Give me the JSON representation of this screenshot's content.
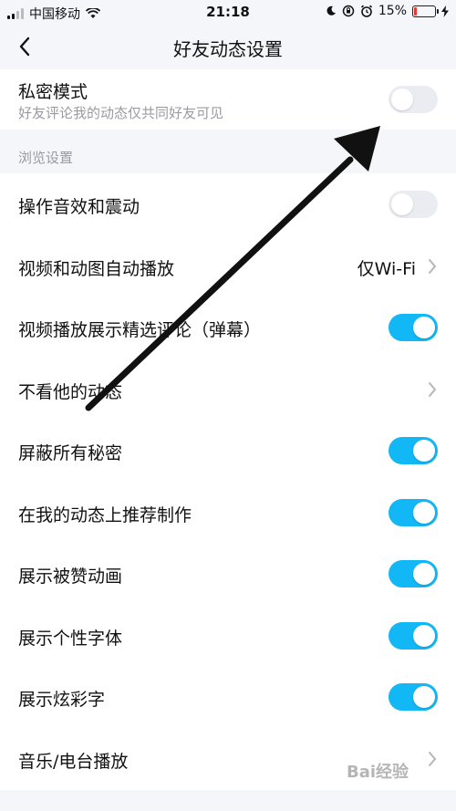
{
  "status_bar": {
    "carrier": "中国移动",
    "time": "21:18",
    "battery_percent": "15%",
    "battery_level": 0.15,
    "icons": [
      "signal-icon",
      "wifi-icon",
      "moon-icon",
      "rotation-lock-icon",
      "alarm-icon",
      "battery-icon",
      "charging-icon"
    ],
    "battery_color": "#e53935"
  },
  "nav": {
    "title": "好友动态设置",
    "back_icon": "chevron-left-icon"
  },
  "privacy": {
    "label": "私密模式",
    "sub": "好友评论我的动态仅共同好友可见",
    "on": false
  },
  "section": {
    "label": "浏览设置"
  },
  "rows": [
    {
      "label": "操作音效和震动",
      "type": "toggle",
      "on": false
    },
    {
      "label": "视频和动图自动播放",
      "type": "link",
      "value": "仅Wi-Fi"
    },
    {
      "label": "视频播放展示精选评论（弹幕）",
      "type": "toggle",
      "on": true
    },
    {
      "label": "不看他的动态",
      "type": "link"
    },
    {
      "label": "屏蔽所有秘密",
      "type": "toggle",
      "on": true
    },
    {
      "label": "在我的动态上推荐制作",
      "type": "toggle",
      "on": true
    },
    {
      "label": "展示被赞动画",
      "type": "toggle",
      "on": true
    },
    {
      "label": "展示个性字体",
      "type": "toggle",
      "on": true
    },
    {
      "label": "展示炫彩字",
      "type": "toggle",
      "on": true
    },
    {
      "label": "音乐/电台播放",
      "type": "link"
    }
  ],
  "watermark": "Bai经验",
  "colors": {
    "accent": "#12b7f5",
    "toggle_off": "#ebecf2",
    "background": "#f5f6fa",
    "secondary_text": "#9a9aa3"
  }
}
